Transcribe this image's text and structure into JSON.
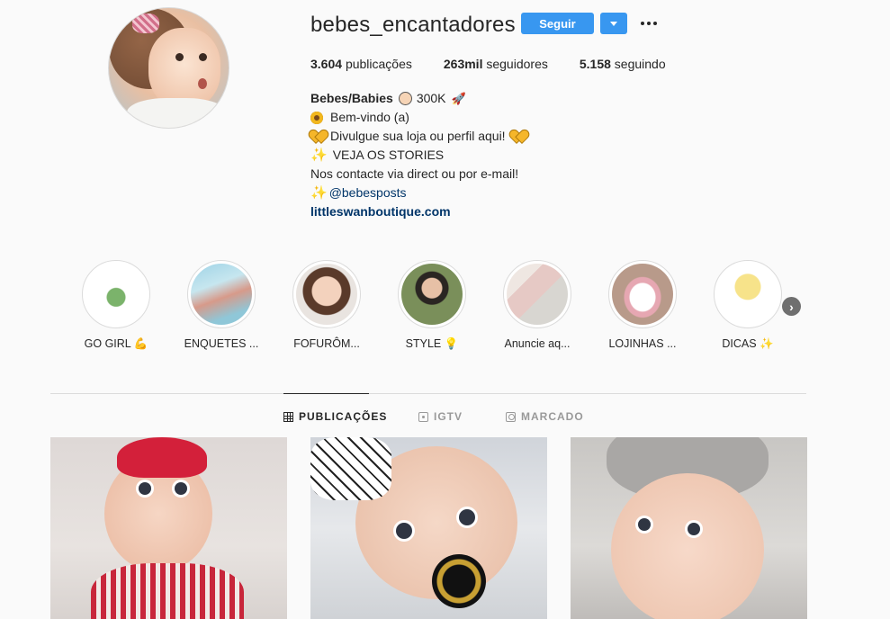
{
  "profile": {
    "username": "bebes_encantadores",
    "follow_label": "Seguir",
    "stats": [
      {
        "count": "3.604",
        "label": "publicações"
      },
      {
        "count": "263mil",
        "label": "seguidores"
      },
      {
        "count": "5.158",
        "label": "seguindo"
      }
    ],
    "bio": {
      "name": "Bebes/Babies",
      "name_suffix": "300K",
      "line1": "Bem-vindo (a)",
      "line2": "Divulgue sua loja ou perfil aqui!",
      "line3": "VEJA OS STORIES",
      "line4": "Nos contacte via direct ou por e-mail!",
      "mention": "@bebesposts",
      "website": "littleswanboutique.com"
    }
  },
  "highlights": [
    {
      "label": "GO GIRL 💪"
    },
    {
      "label": "ENQUETES ..."
    },
    {
      "label": "FOFURÔM..."
    },
    {
      "label": "STYLE 💡"
    },
    {
      "label": "Anuncie aq..."
    },
    {
      "label": "LOJINHAS ..."
    },
    {
      "label": "DICAS ✨"
    }
  ],
  "tabs": [
    {
      "label": "PUBLICAÇÕES",
      "icon": "grid-icon"
    },
    {
      "label": "IGTV",
      "icon": "igtv-icon"
    },
    {
      "label": "MARCADO",
      "icon": "tag-icon"
    }
  ],
  "colors": {
    "accent": "#3897f0",
    "link": "#003569",
    "text": "#262626",
    "muted": "#999999",
    "background": "#fafafa"
  }
}
